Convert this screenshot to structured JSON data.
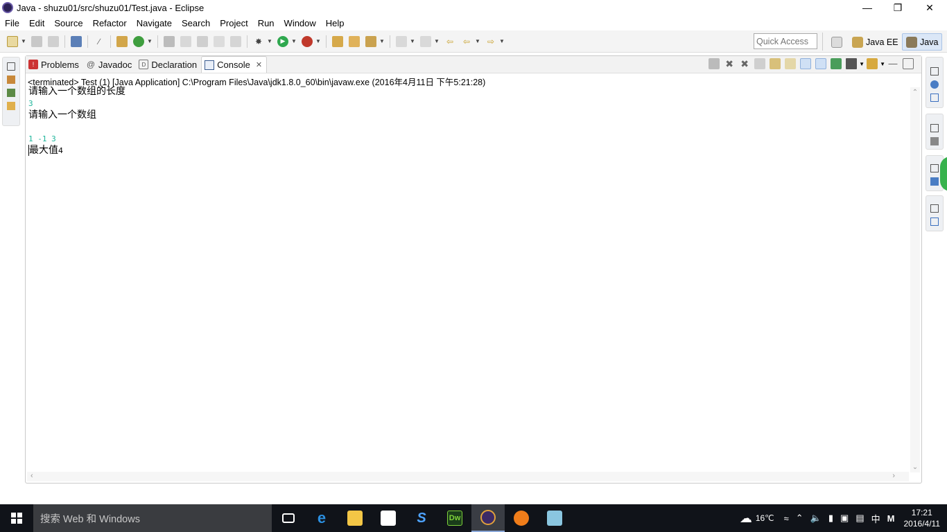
{
  "window": {
    "title": "Java - shuzu01/src/shuzu01/Test.java - Eclipse"
  },
  "menu": [
    "File",
    "Edit",
    "Source",
    "Refactor",
    "Navigate",
    "Search",
    "Project",
    "Run",
    "Window",
    "Help"
  ],
  "quick_access": {
    "placeholder": "Quick Access"
  },
  "perspectives": {
    "java_ee": "Java EE",
    "java": "Java"
  },
  "tabs": {
    "problems": "Problems",
    "javadoc": "Javadoc",
    "declaration": "Declaration",
    "console": "Console"
  },
  "console": {
    "header": "<terminated> Test (1) [Java Application] C:\\Program Files\\Java\\jdk1.8.0_60\\bin\\javaw.exe (2016年4月11日 下午5:21:28)",
    "line1": "请输入一个数组的长度",
    "input1": "3",
    "line2": "请输入一个数组",
    "input2": "1 -1 3",
    "line3_label": "最大值",
    "line3_value": "4"
  },
  "taskbar": {
    "search_placeholder": "搜索 Web 和 Windows",
    "weather": "16℃",
    "ime": "中",
    "ime2": "M",
    "time": "17:21",
    "date": "2016/4/11"
  },
  "colors": {
    "console_input": "#1db59a",
    "taskbar_bg": "#101319"
  }
}
